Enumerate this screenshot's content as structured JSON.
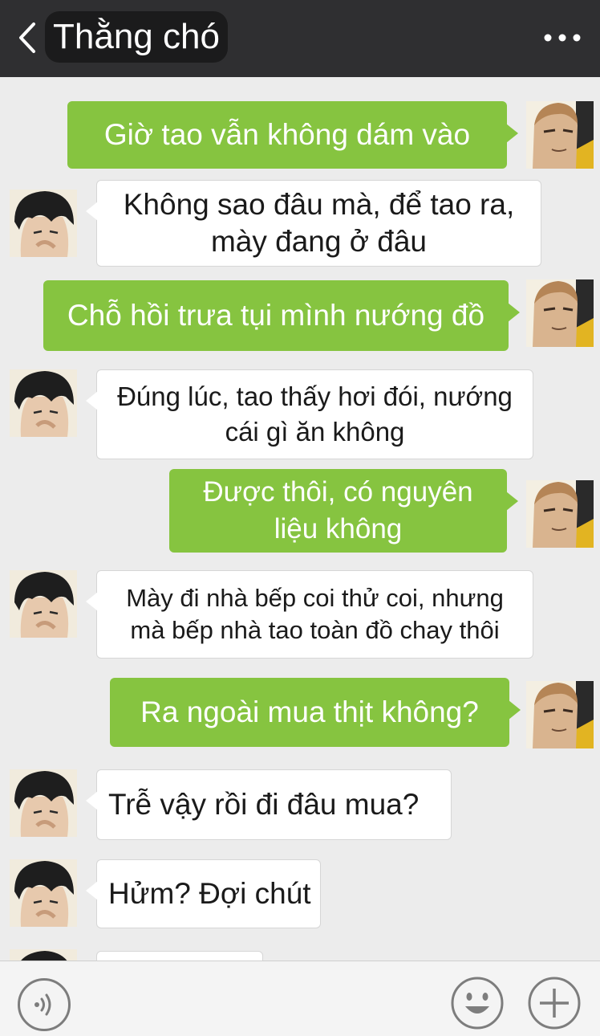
{
  "header": {
    "back_icon": "chevron-left-icon",
    "title": "Thằng chó",
    "more_icon": "ellipsis-icon"
  },
  "messages": [
    {
      "side": "sent",
      "text": "Giờ tao vẫn không dám vào"
    },
    {
      "side": "received",
      "text": "Không sao đâu mà, để tao ra, mày đang ở đâu"
    },
    {
      "side": "sent",
      "text": "Chỗ hồi trưa tụi mình nướng đồ"
    },
    {
      "side": "received",
      "text": "Đúng lúc, tao thấy hơi đói, nướng cái gì ăn không"
    },
    {
      "side": "sent",
      "text": "Được thôi, có nguyên liệu không"
    },
    {
      "side": "received",
      "text": "Mày đi nhà bếp coi thử coi, nhưng mà bếp nhà tao toàn đồ chay thôi"
    },
    {
      "side": "sent",
      "text": "Ra ngoài mua thịt không?"
    },
    {
      "side": "received",
      "text": "Trễ vậy rồi đi đâu mua?"
    },
    {
      "side": "received",
      "text": "Hửm? Đợi chút"
    }
  ],
  "input_bar": {
    "voice_icon": "voice-icon",
    "emoji_icon": "emoji-icon",
    "plus_icon": "plus-icon"
  },
  "colors": {
    "header_bg": "#2f2f31",
    "chat_bg": "#ececec",
    "sent_bubble": "#86c440",
    "received_bubble": "#ffffff",
    "icon_gray": "#7d7d7d"
  }
}
